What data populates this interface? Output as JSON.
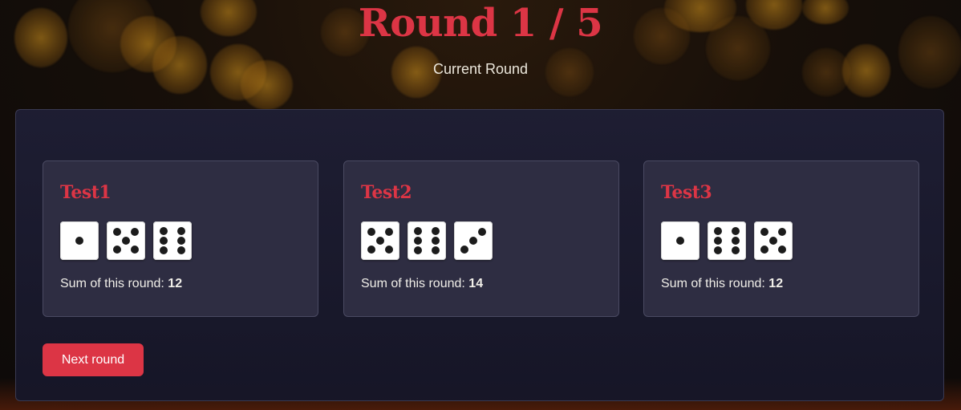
{
  "header": {
    "title": "Round 1 / 5",
    "subtitle": "Current Round"
  },
  "players": [
    {
      "name": "Test1",
      "dice": [
        1,
        5,
        6
      ],
      "sum_label": "Sum of this round:",
      "sum": "12"
    },
    {
      "name": "Test2",
      "dice": [
        5,
        6,
        3
      ],
      "sum_label": "Sum of this round:",
      "sum": "14"
    },
    {
      "name": "Test3",
      "dice": [
        1,
        6,
        5
      ],
      "sum_label": "Sum of this round:",
      "sum": "12"
    }
  ],
  "actions": {
    "next_round_label": "Next round"
  },
  "colors": {
    "accent": "#dc3545",
    "panel_bg": "#1e1e34",
    "card_bg": "#2e2d42",
    "die_face": "#ffffff",
    "pip": "#1c1c1c"
  },
  "icons": {
    "die": "die-face-icon"
  }
}
